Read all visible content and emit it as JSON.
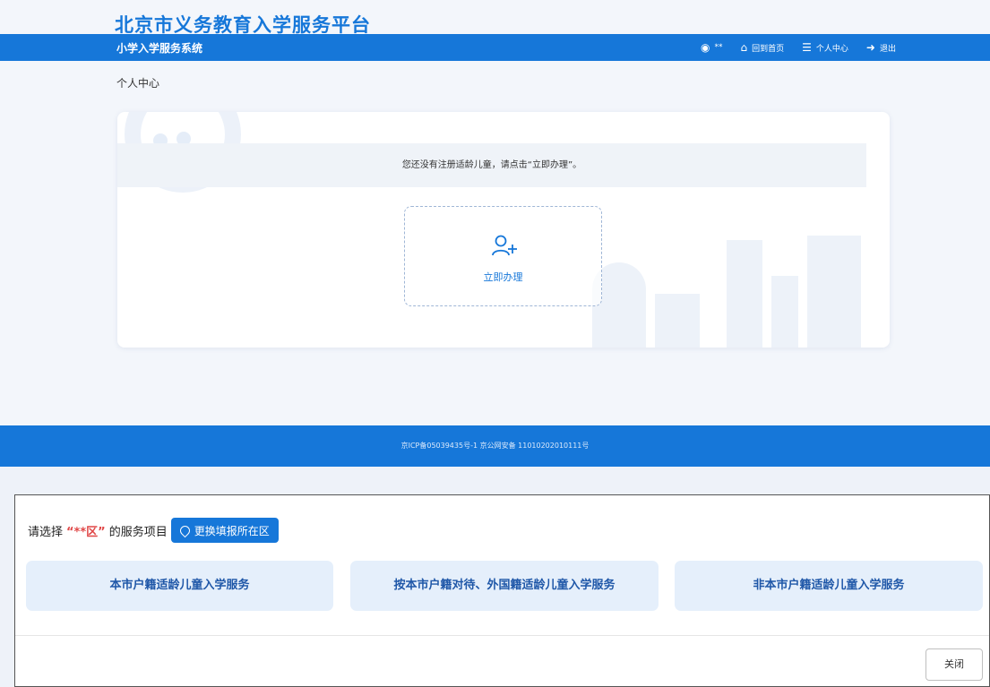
{
  "site": {
    "title": "北京市义务教育入学服务平台",
    "system_name": "小学入学服务系统",
    "nav": {
      "user_label": "**",
      "home_label": "回到首页",
      "center_label": "个人中心",
      "logout_label": "退出"
    },
    "breadcrumb": "个人中心",
    "notice": "您还没有注册适龄儿童，请点击“立即办理”。",
    "action_label": "立即办理",
    "footer_text": "京ICP备05039435号-1 京公网安备 11010202010111号",
    "colors": {
      "primary": "#1677d9",
      "panel": "#eff3f8"
    }
  },
  "dialog": {
    "prompt_prefix": "请选择",
    "district": "“**区”",
    "prompt_suffix": "的服务项目",
    "change_button": "更换填报所在区",
    "services": [
      "本市户籍适龄儿童入学服务",
      "按本市户籍对待、外国籍适龄儿童入学服务",
      "非本市户籍适龄儿童入学服务"
    ],
    "close_button": "关闭"
  }
}
